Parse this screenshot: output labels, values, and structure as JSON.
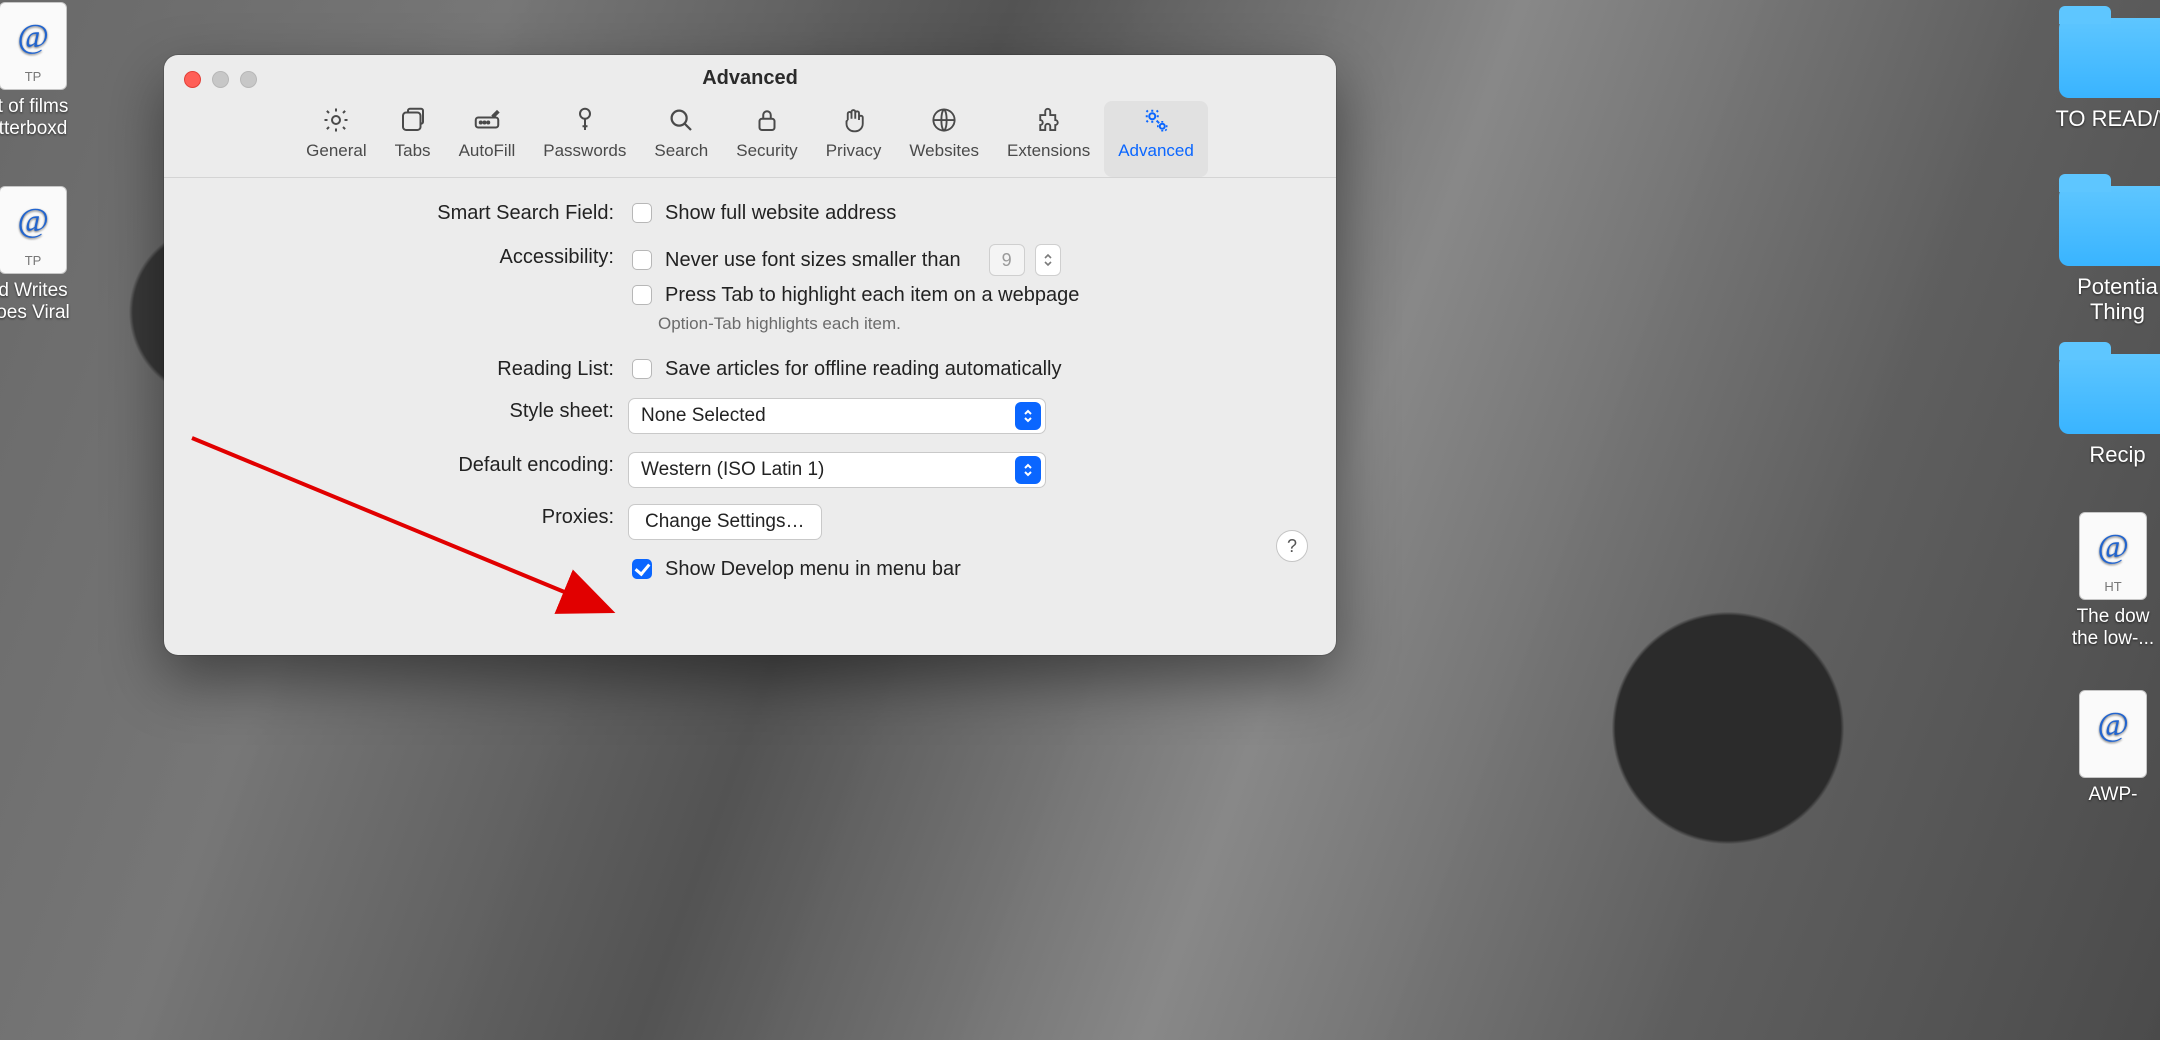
{
  "window": {
    "title": "Advanced"
  },
  "toolbar": {
    "items": [
      {
        "id": "general",
        "label": "General"
      },
      {
        "id": "tabs",
        "label": "Tabs"
      },
      {
        "id": "autofill",
        "label": "AutoFill"
      },
      {
        "id": "passwords",
        "label": "Passwords"
      },
      {
        "id": "search",
        "label": "Search"
      },
      {
        "id": "security",
        "label": "Security"
      },
      {
        "id": "privacy",
        "label": "Privacy"
      },
      {
        "id": "websites",
        "label": "Websites"
      },
      {
        "id": "extensions",
        "label": "Extensions"
      },
      {
        "id": "advanced",
        "label": "Advanced",
        "active": true
      }
    ]
  },
  "sections": {
    "smart_search": {
      "label": "Smart Search Field:",
      "show_full_address": {
        "label": "Show full website address",
        "checked": false
      }
    },
    "accessibility": {
      "label": "Accessibility:",
      "min_font": {
        "label": "Never use font sizes smaller than",
        "checked": false,
        "value": "9"
      },
      "press_tab": {
        "label": "Press Tab to highlight each item on a webpage",
        "checked": false
      },
      "hint": "Option-Tab highlights each item."
    },
    "reading_list": {
      "label": "Reading List:",
      "save_offline": {
        "label": "Save articles for offline reading automatically",
        "checked": false
      }
    },
    "style_sheet": {
      "label": "Style sheet:",
      "value": "None Selected"
    },
    "default_encoding": {
      "label": "Default encoding:",
      "value": "Western (ISO Latin 1)"
    },
    "proxies": {
      "label": "Proxies:",
      "button": "Change Settings…"
    },
    "develop": {
      "label": "Show Develop menu in menu bar",
      "checked": true
    }
  },
  "help_glyph": "?",
  "desktop": {
    "left_icons": [
      {
        "name": "films-webloc",
        "ext": "TP",
        "label": "t of films\ntterboxd"
      },
      {
        "name": "writes-webloc",
        "ext": "TP",
        "label": "d Writes\noes Viral"
      }
    ],
    "right_folders": [
      {
        "name": "to-read-folder",
        "label": "TO READ/W"
      },
      {
        "name": "potential-folder",
        "label": "Potentia\nThing"
      },
      {
        "name": "recipes-folder",
        "label": "Recip"
      }
    ],
    "right_icons": [
      {
        "name": "downside-webloc",
        "ext": "HT",
        "label": "The dow\nthe low-..."
      },
      {
        "name": "awp-webloc",
        "ext": "",
        "label": "AWP-"
      }
    ]
  }
}
